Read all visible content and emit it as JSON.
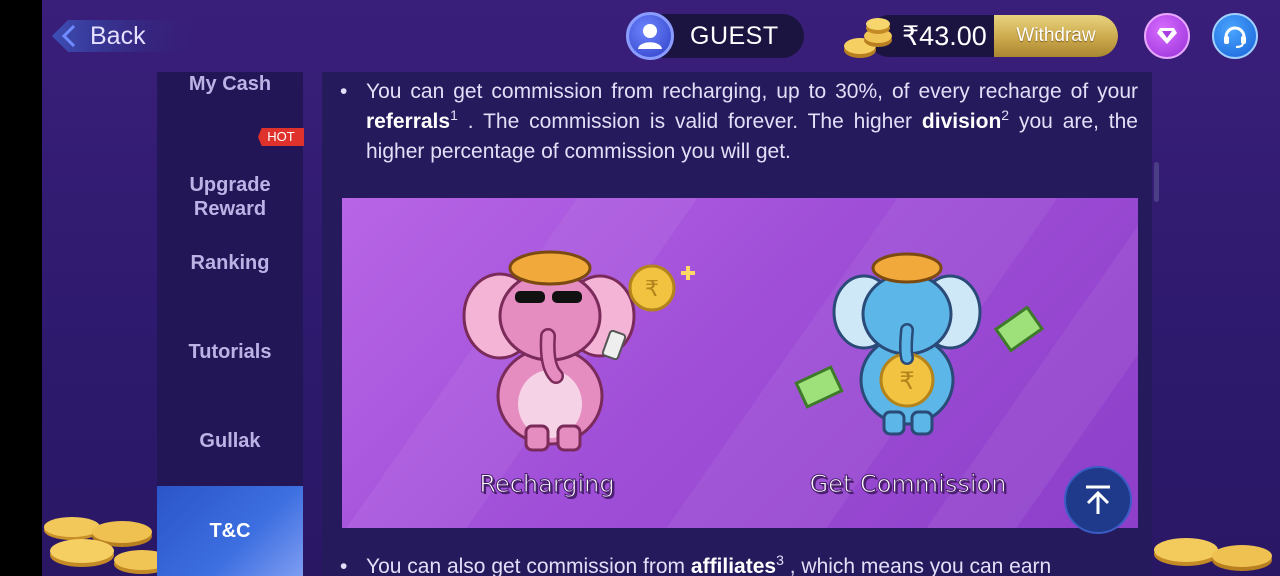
{
  "header": {
    "back_label": "Back",
    "username": "GUEST",
    "balance": "₹43.00",
    "withdraw_label": "Withdraw"
  },
  "sidebar": {
    "items": [
      {
        "label": "My Cash"
      },
      {
        "label": "Upgrade\nReward",
        "badge": "HOT"
      },
      {
        "label": "Ranking"
      },
      {
        "label": "Tutorials"
      },
      {
        "label": "Gullak"
      },
      {
        "label": "T&C",
        "active": true
      }
    ]
  },
  "content": {
    "para1": {
      "t1": "You can get commission from recharging, up to 30%, of every recharge of your",
      "b1": "referrals",
      "s1": "1",
      "t2": ". The commission is valid forever. The higher",
      "b2": "division",
      "s2": "2",
      "t3": "you are, the higher percentage of commission you will get."
    },
    "promo": {
      "label_left": "Recharging",
      "label_right": "Get Commission"
    },
    "para2": {
      "t1": "You can also get commission from",
      "b1": "affiliates",
      "s1": "3",
      "t2": ", which means you can earn"
    }
  },
  "colors": {
    "background": "#2e1a6e",
    "sidebar": "#231656",
    "active_tab": "#3d6fe0",
    "hot_badge": "#e0322c",
    "withdraw_gold": "#c9a548",
    "promo_purple": "#a04fd8"
  },
  "icons": [
    "back-arrow-icon",
    "user-avatar-icon",
    "gold-coins-icon",
    "diamond-vip-icon",
    "headset-support-icon",
    "arrow-to-top-icon"
  ]
}
